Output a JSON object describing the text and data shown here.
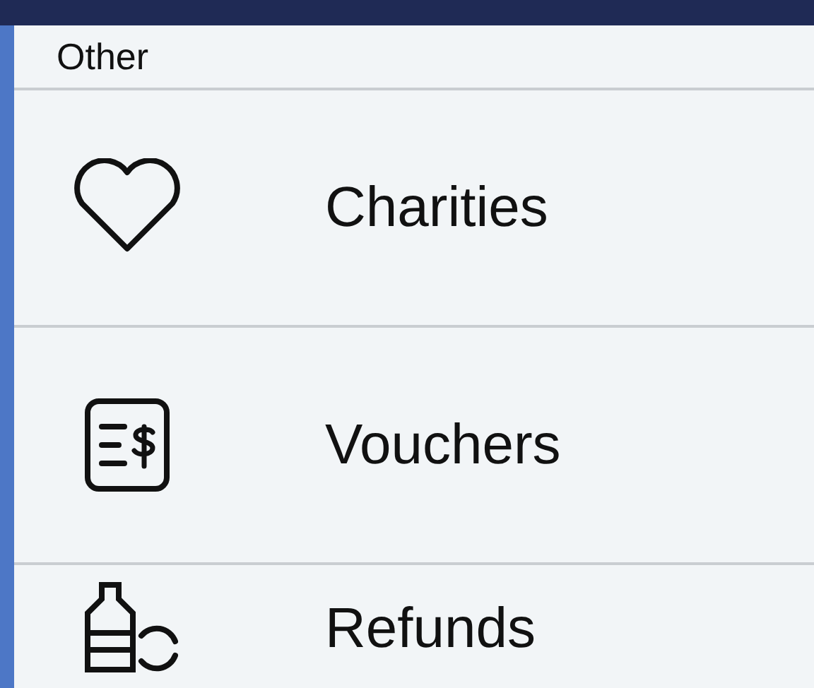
{
  "section_header": "Other",
  "items": [
    {
      "label": "Charities",
      "kind": "heart"
    },
    {
      "label": "Vouchers",
      "kind": "voucher"
    },
    {
      "label": "Refunds",
      "kind": "refund"
    }
  ]
}
